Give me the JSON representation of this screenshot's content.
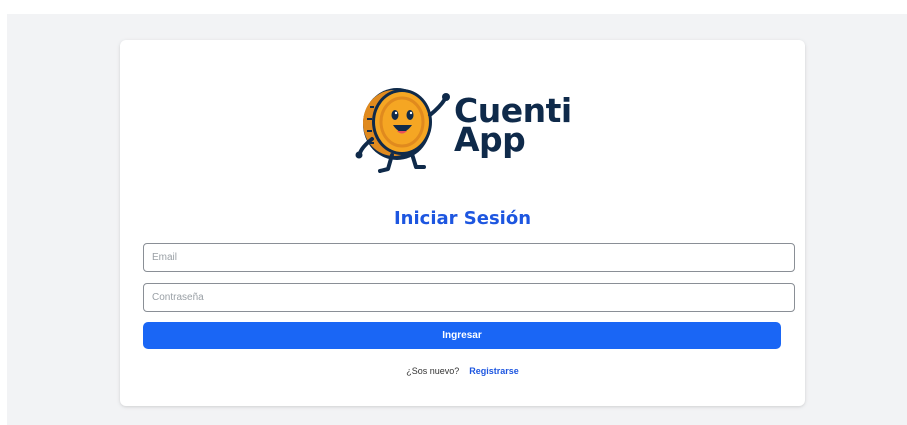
{
  "brand": {
    "logo_line1": "Cuenti",
    "logo_line2": "App",
    "logo_icon": "coin-mascot-icon",
    "text_color": "#0f2a4a",
    "coin_color": "#f5a623"
  },
  "login": {
    "title": "Iniciar Sesión",
    "email_placeholder": "Email",
    "password_placeholder": "Contraseña",
    "submit_label": "Ingresar",
    "new_user_prompt": "¿Sos nuevo?",
    "register_link": "Registrarse"
  },
  "colors": {
    "accent": "#1a66f5",
    "title": "#1d56e0",
    "background": "#f2f3f5"
  }
}
